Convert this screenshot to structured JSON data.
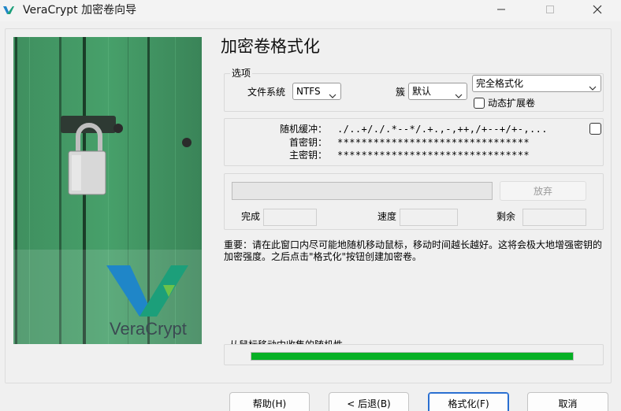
{
  "window": {
    "title": "VeraCrypt 加密卷向导",
    "app_icon": "veracrypt-logo-icon",
    "controls": {
      "minimize": "minimize-icon",
      "maximize": "maximize-icon",
      "close": "close-icon"
    }
  },
  "illustration": {
    "brand": "VeraCrypt",
    "description_icons": [
      "padlock-icon",
      "veracrypt-logo-icon"
    ]
  },
  "page": {
    "heading": "加密卷格式化"
  },
  "options": {
    "legend": "选项",
    "filesystem_label": "文件系统",
    "filesystem_value": "NTFS",
    "cluster_label": "簇",
    "cluster_value": "默认",
    "format_mode_value": "完全格式化",
    "dynamic_label": "动态扩展卷",
    "dynamic_checked": false
  },
  "keys": {
    "random_pool_label": "随机缓冲：",
    "random_pool_value": "./..+/./.*--*/.+.,-,++,/+--+/+-,...",
    "header_key_label": "首密钥：",
    "header_key_value": "********************************",
    "master_key_label": "主密钥：",
    "master_key_value": "********************************",
    "show_checked": false
  },
  "progress": {
    "abort_label": "放弃",
    "done_label": "完成",
    "done_value": "",
    "speed_label": "速度",
    "speed_value": "",
    "left_label": "剩余",
    "left_value": ""
  },
  "note": "重要：请在此窗口内尽可能地随机移动鼠标，移动时间越长越好。这将会极大地增强密钥的加密强度。之后点击\"格式化\"按钮创建加密卷。",
  "entropy": {
    "label": "从鼠标移动中收集的随机性",
    "fraction": 1.0,
    "color": "#06b025"
  },
  "buttons": {
    "help": "帮助(H)",
    "back": "< 后退(B)",
    "format": "格式化(F)",
    "cancel": "取消"
  },
  "colors": {
    "accent": "#2a6fd1",
    "progress_green": "#06b025",
    "logo_blue": "#1f86c8"
  }
}
